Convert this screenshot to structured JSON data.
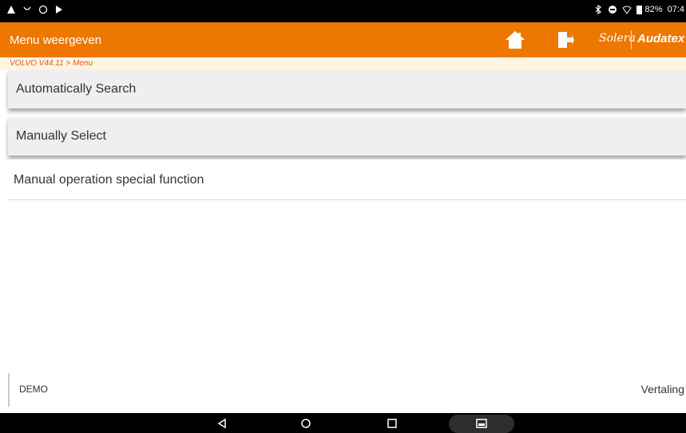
{
  "status_bar": {
    "battery_percent": "82%",
    "time": "07:4"
  },
  "app_bar": {
    "title": "Menu weergeven",
    "brand_solera": "Solera",
    "brand_audatex": "Audatex"
  },
  "breadcrumb": "VOLVO V44.11 > Menu",
  "menu": {
    "items": [
      {
        "label": "Automatically Search"
      },
      {
        "label": "Manually Select"
      },
      {
        "label": "Manual operation special function"
      }
    ]
  },
  "footer": {
    "left_text": "DEMO",
    "right_text": "Vertaling"
  },
  "colors": {
    "accent": "#ee7700",
    "breadcrumb_text": "#e25a1c"
  }
}
